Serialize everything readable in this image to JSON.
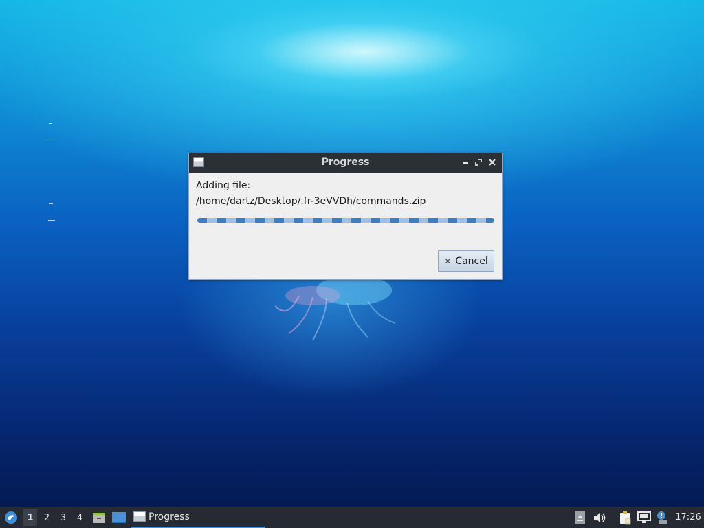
{
  "dialog": {
    "title": "Progress",
    "message_line1": "Adding file:",
    "message_line2": "/home/dartz/Desktop/.fr-3eVVDh/commands.zip",
    "cancel_label": "Cancel",
    "progress_state": "indeterminate"
  },
  "taskbar": {
    "workspaces": [
      "1",
      "2",
      "3",
      "4"
    ],
    "active_workspace": "1",
    "task_label": "Progress",
    "clock": "17:26"
  },
  "icons": {
    "menu": "start-menu-icon",
    "file_manager": "file-manager-icon",
    "show_desktop": "show-desktop-icon",
    "eject": "eject-icon",
    "volume": "volume-icon",
    "clipboard": "clipboard-icon",
    "network": "network-icon",
    "notification": "notification-icon"
  },
  "colors": {
    "taskbar_bg": "#262b33",
    "titlebar_bg": "#2b2f36",
    "accent": "#4a90d9",
    "dialog_bg": "#efefef"
  }
}
